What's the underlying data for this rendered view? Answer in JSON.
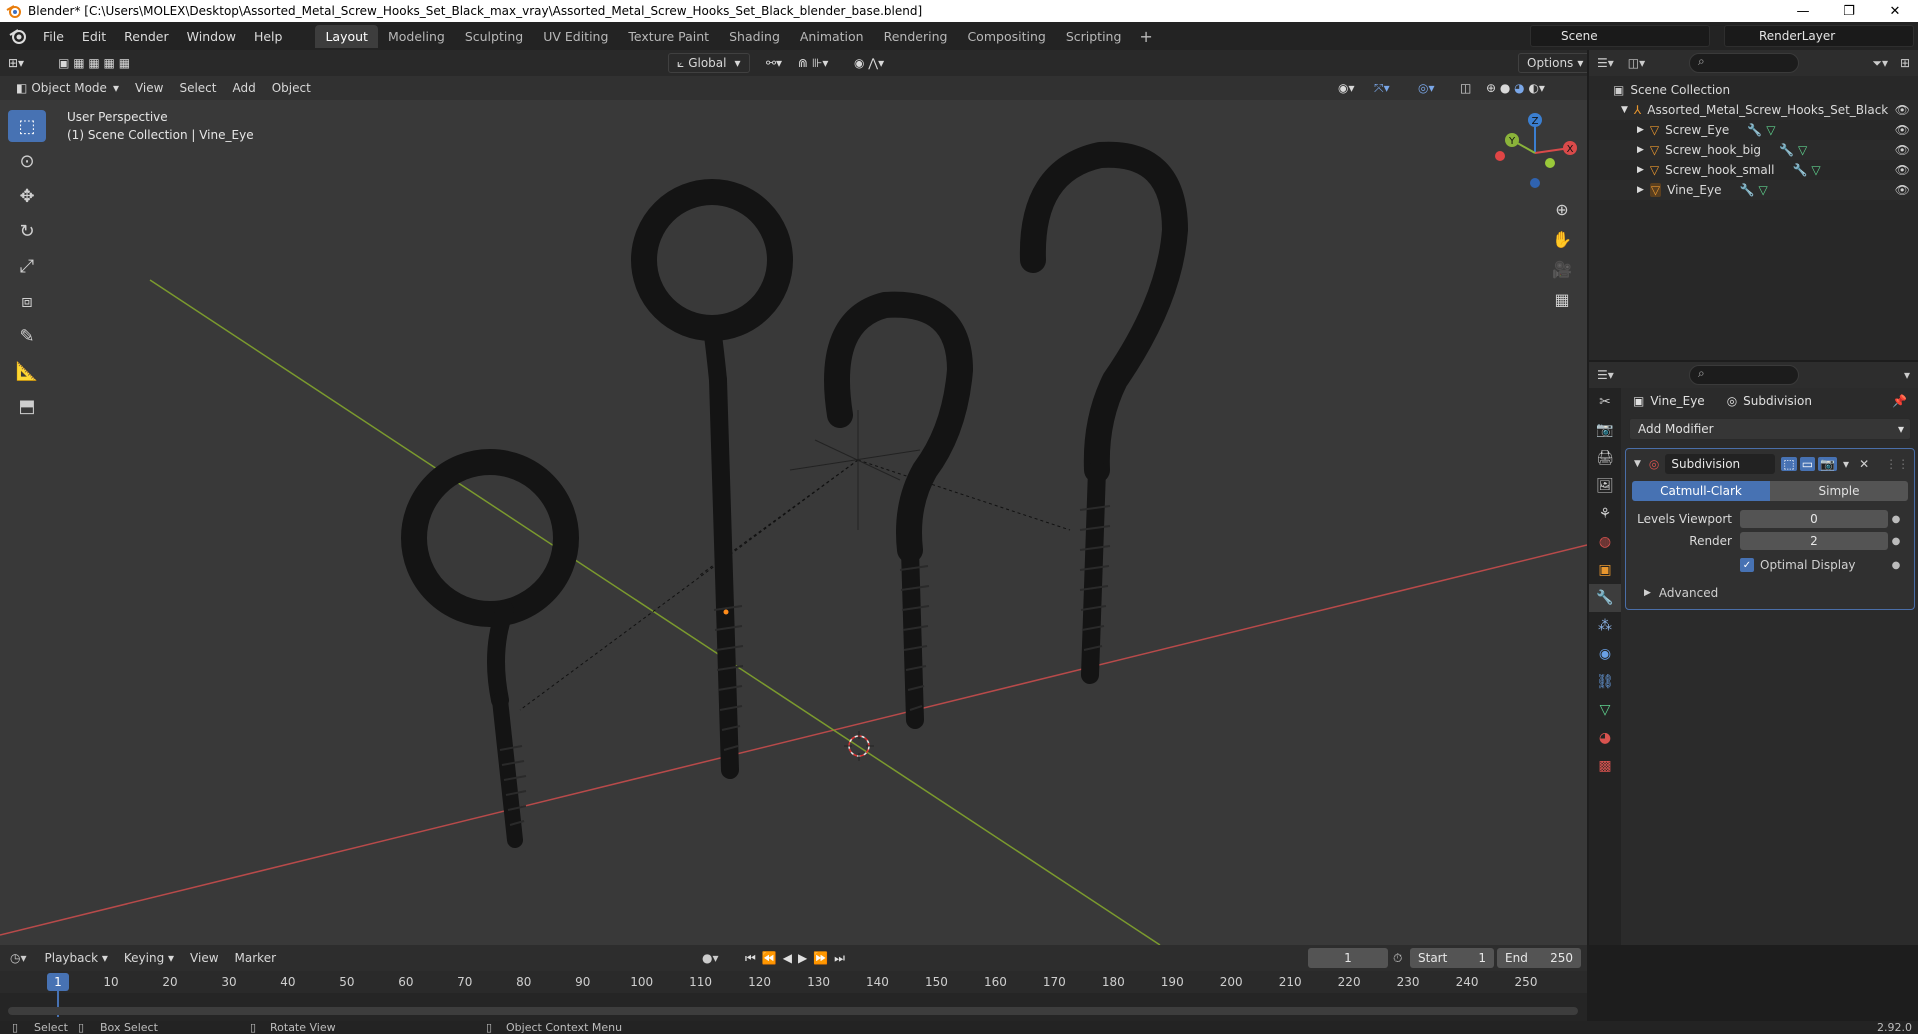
{
  "window": {
    "title": "Blender* [C:\\Users\\MOLEX\\Desktop\\Assorted_Metal_Screw_Hooks_Set_Black_max_vray\\Assorted_Metal_Screw_Hooks_Set_Black_blender_base.blend]",
    "minimize": "—",
    "maximize": "❐",
    "close": "✕"
  },
  "menubar": {
    "menus": [
      "File",
      "Edit",
      "Render",
      "Window",
      "Help"
    ],
    "tabs": [
      "Layout",
      "Modeling",
      "Sculpting",
      "UV Editing",
      "Texture Paint",
      "Shading",
      "Animation",
      "Rendering",
      "Compositing",
      "Scripting"
    ],
    "active_tab": "Layout",
    "add_tab": "+",
    "scene": "Scene",
    "render_layer": "RenderLayer"
  },
  "viewport": {
    "mode": "Object Mode",
    "menus": [
      "View",
      "Select",
      "Add",
      "Object"
    ],
    "transform_orientation": "Global",
    "options": "Options",
    "info_line1": "User Perspective",
    "info_line2": "(1) Scene Collection | Vine_Eye",
    "gizmo": {
      "x": "X",
      "y": "Y",
      "z": "Z"
    },
    "colors": {
      "x_axis": "#d94a4a",
      "y_axis": "#8ab33a",
      "z_axis": "#3b7fd1",
      "bg": "#393939"
    }
  },
  "outliner": {
    "root": "Scene Collection",
    "collection": "Assorted_Metal_Screw_Hooks_Set_Black",
    "objects": [
      "Screw_Eye",
      "Screw_hook_big",
      "Screw_hook_small",
      "Vine_Eye"
    ]
  },
  "properties": {
    "object": "Vine_Eye",
    "modifier_breadcrumb": "Subdivision",
    "add_modifier": "Add Modifier",
    "modifier": {
      "name": "Subdivision",
      "type_options": [
        "Catmull-Clark",
        "Simple"
      ],
      "active_type": "Catmull-Clark",
      "levels_viewport_label": "Levels Viewport",
      "levels_viewport": "0",
      "render_label": "Render",
      "render": "2",
      "optimal_display": "Optimal Display",
      "advanced": "Advanced"
    }
  },
  "timeline": {
    "menus": [
      "Playback",
      "Keying",
      "View",
      "Marker"
    ],
    "current_frame": "1",
    "start_label": "Start",
    "start": "1",
    "end_label": "End",
    "end": "250",
    "ticks": [
      "1",
      "10",
      "20",
      "30",
      "40",
      "50",
      "60",
      "70",
      "80",
      "90",
      "100",
      "110",
      "120",
      "130",
      "140",
      "150",
      "160",
      "170",
      "180",
      "190",
      "200",
      "210",
      "220",
      "230",
      "240",
      "250"
    ]
  },
  "statusbar": {
    "select": "Select",
    "box_select": "Box Select",
    "rotate_view": "Rotate View",
    "context_menu": "Object Context Menu",
    "version": "2.92.0"
  }
}
